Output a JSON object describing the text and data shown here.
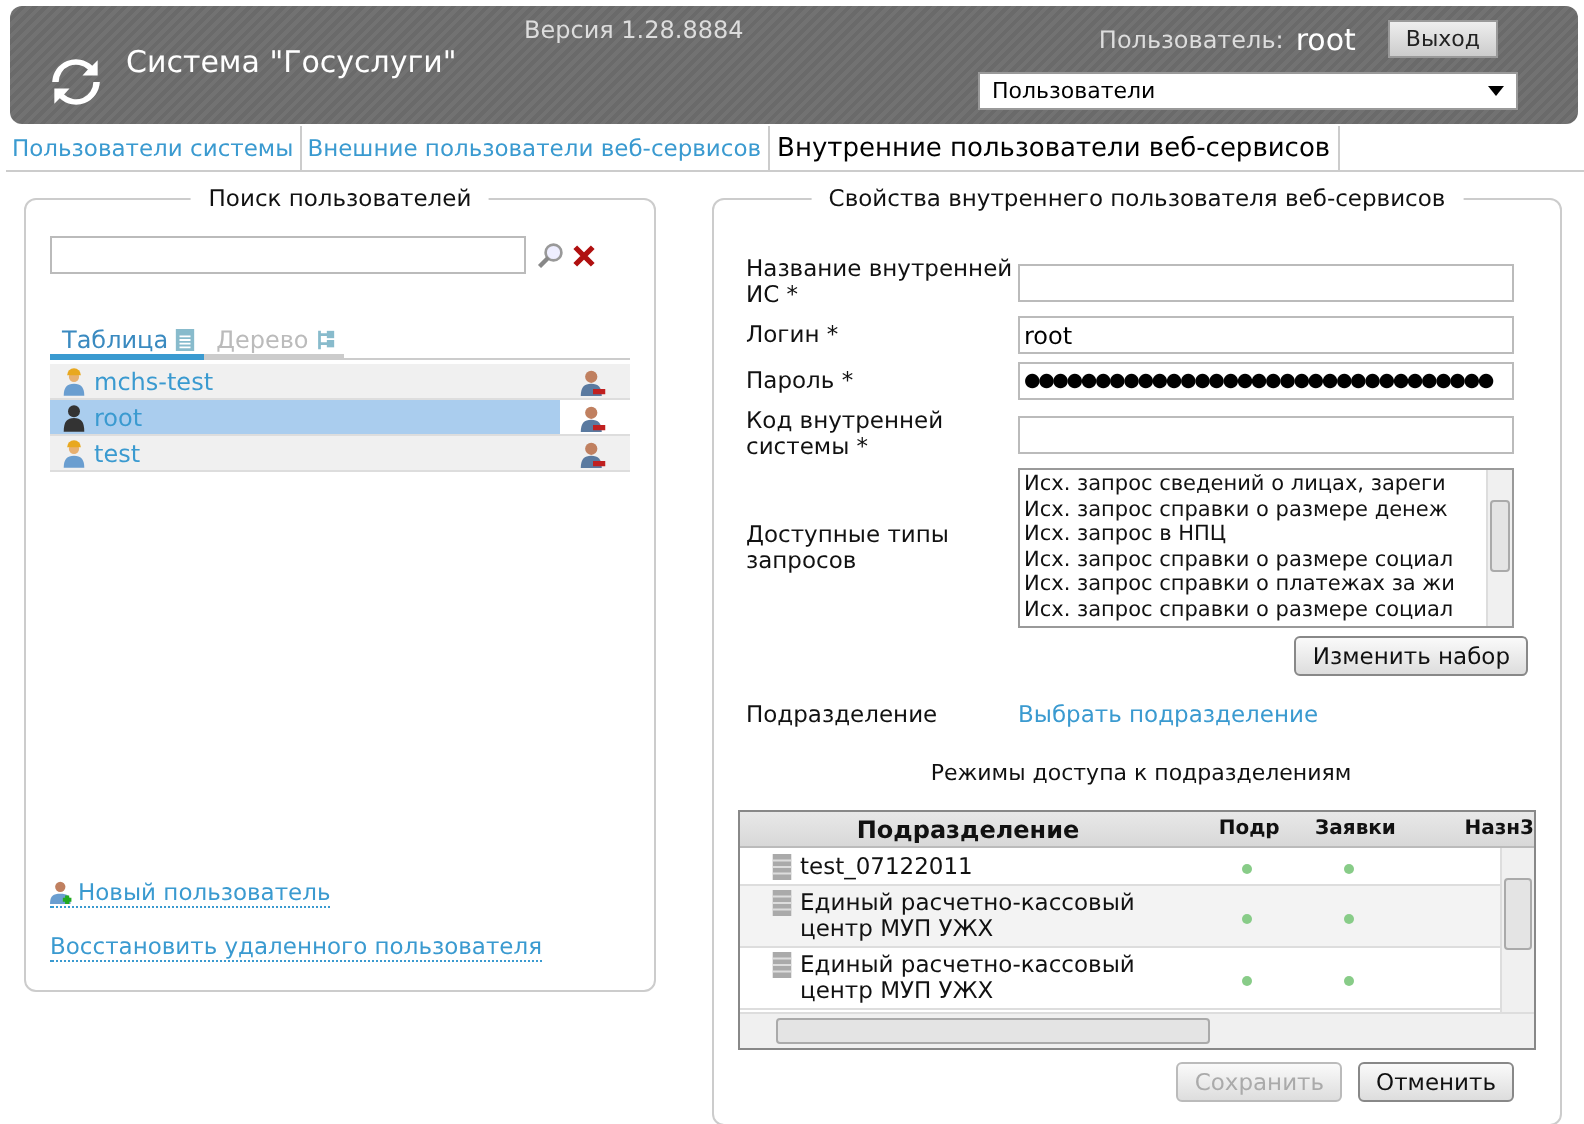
{
  "header": {
    "title": "Система \"Госуслуги\"",
    "version": "Версия 1.28.8884",
    "user_label": "Пользователь:",
    "user_name": "root",
    "logout": "Выход",
    "section_select": "Пользователи"
  },
  "tabs": [
    {
      "label": "Пользователи системы",
      "selected": false
    },
    {
      "label": "Внешние пользователи веб-сервисов",
      "selected": false
    },
    {
      "label": "Внутренние пользователи веб-сервисов",
      "selected": true
    }
  ],
  "search_panel": {
    "title": "Поиск пользователей",
    "view_tabs": [
      {
        "label": "Таблица",
        "selected": true
      },
      {
        "label": "Дерево",
        "selected": false
      }
    ],
    "users": [
      {
        "name": "mchs-test",
        "selected": false,
        "kind": "external"
      },
      {
        "name": "root",
        "selected": true,
        "kind": "admin"
      },
      {
        "name": "test",
        "selected": false,
        "kind": "external"
      }
    ],
    "new_user": "Новый пользователь",
    "restore_user": "Восстановить удаленного пользователя"
  },
  "properties": {
    "title": "Свойства внутреннего пользователя веб-сервисов",
    "fields": [
      {
        "label": "Название внутренней ИС *",
        "kind": "text"
      },
      {
        "label": "Логин *",
        "value": "root",
        "kind": "text"
      },
      {
        "label": "Пароль *",
        "value": "●●●●●●●●●●●●●●●●●●●●●●●●●●●●●●●●●",
        "kind": "password"
      },
      {
        "label": "Код внутренней системы *",
        "kind": "text"
      }
    ],
    "request_types_label": "Доступные типы запросов",
    "request_types": [
      "Исх. запрос сведений о лицах, зареги",
      "Исх. запрос справки о размере денеж",
      "Исх. запрос в НПЦ",
      "Исх. запрос справки о размере социал",
      "Исх. запрос справки о платежах за жи",
      "Исх. запрос справки о размере социал"
    ],
    "change_set": "Изменить набор",
    "department_label": "Подразделение",
    "department_link": "Выбрать подразделение",
    "access_title": "Режимы доступа к подразделениям",
    "access_columns": [
      "Подразделение",
      "Подр",
      "Заявки",
      "Назн3"
    ],
    "access_rows": [
      {
        "name": "test_07122011",
        "access": [
          true,
          true,
          false
        ]
      },
      {
        "name": "Единый расчетно-кассовый центр МУП УЖХ",
        "access": [
          true,
          true,
          false
        ]
      },
      {
        "name": "Единый расчетно-кассовый центр МУП УЖХ",
        "access": [
          true,
          true,
          false
        ]
      }
    ],
    "save": "Сохранить",
    "save_disabled": true,
    "cancel": "Отменить"
  }
}
